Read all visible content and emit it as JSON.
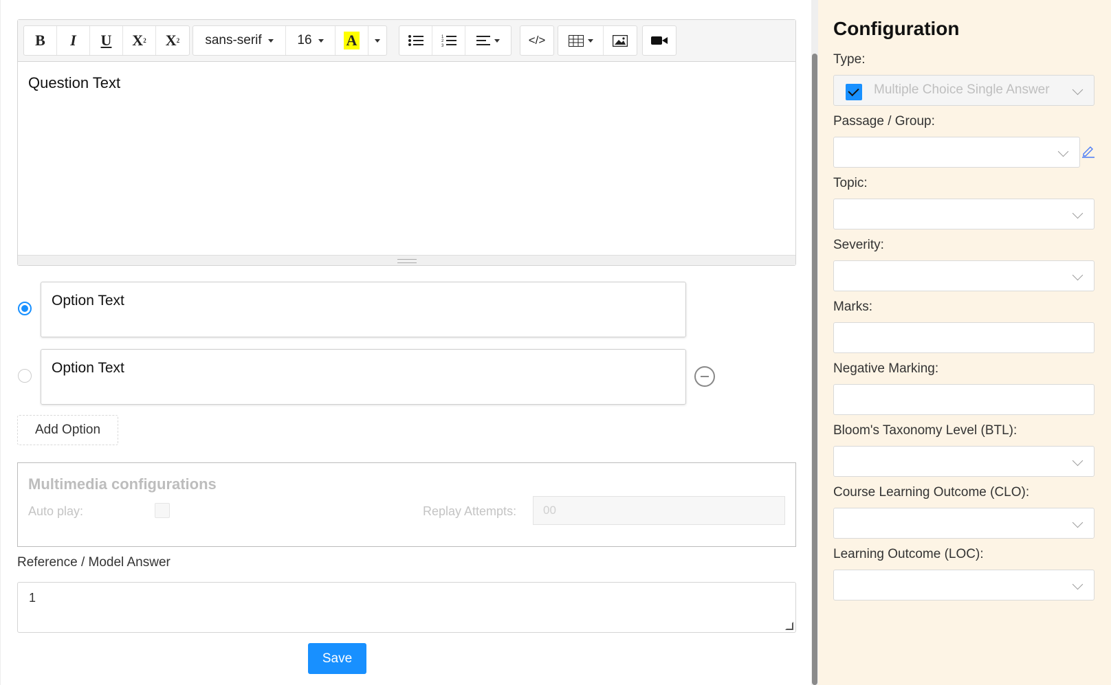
{
  "editor": {
    "toolbar": {
      "bold": "B",
      "italic": "I",
      "underline": "U",
      "superscript": "X",
      "subscript": "X",
      "font_family": "sans-serif",
      "font_size": "16",
      "highlight": "A",
      "code": "</>"
    },
    "question_text": "Question Text"
  },
  "options": [
    {
      "text": "Option Text",
      "selected": true
    },
    {
      "text": "Option Text",
      "selected": false
    }
  ],
  "add_option_label": "Add Option",
  "multimedia": {
    "title": "Multimedia configurations",
    "auto_play_label": "Auto play:",
    "replay_label": "Replay Attempts:",
    "replay_placeholder": "00"
  },
  "reference": {
    "label": "Reference / Model Answer",
    "value": "1"
  },
  "save_label": "Save",
  "config": {
    "title": "Configuration",
    "type_label": "Type:",
    "type_value": "Multiple Choice Single Answer",
    "passage_label": "Passage / Group:",
    "topic_label": "Topic:",
    "severity_label": "Severity:",
    "marks_label": "Marks:",
    "negative_label": "Negative Marking:",
    "btl_label": "Bloom's Taxonomy Level (BTL):",
    "clo_label": "Course Learning Outcome (CLO):",
    "loc_label": "Learning Outcome (LOC):"
  },
  "colors": {
    "accent": "#1890ff",
    "config_bg": "#fdf4e5",
    "highlight_yellow": "#ffff00"
  }
}
